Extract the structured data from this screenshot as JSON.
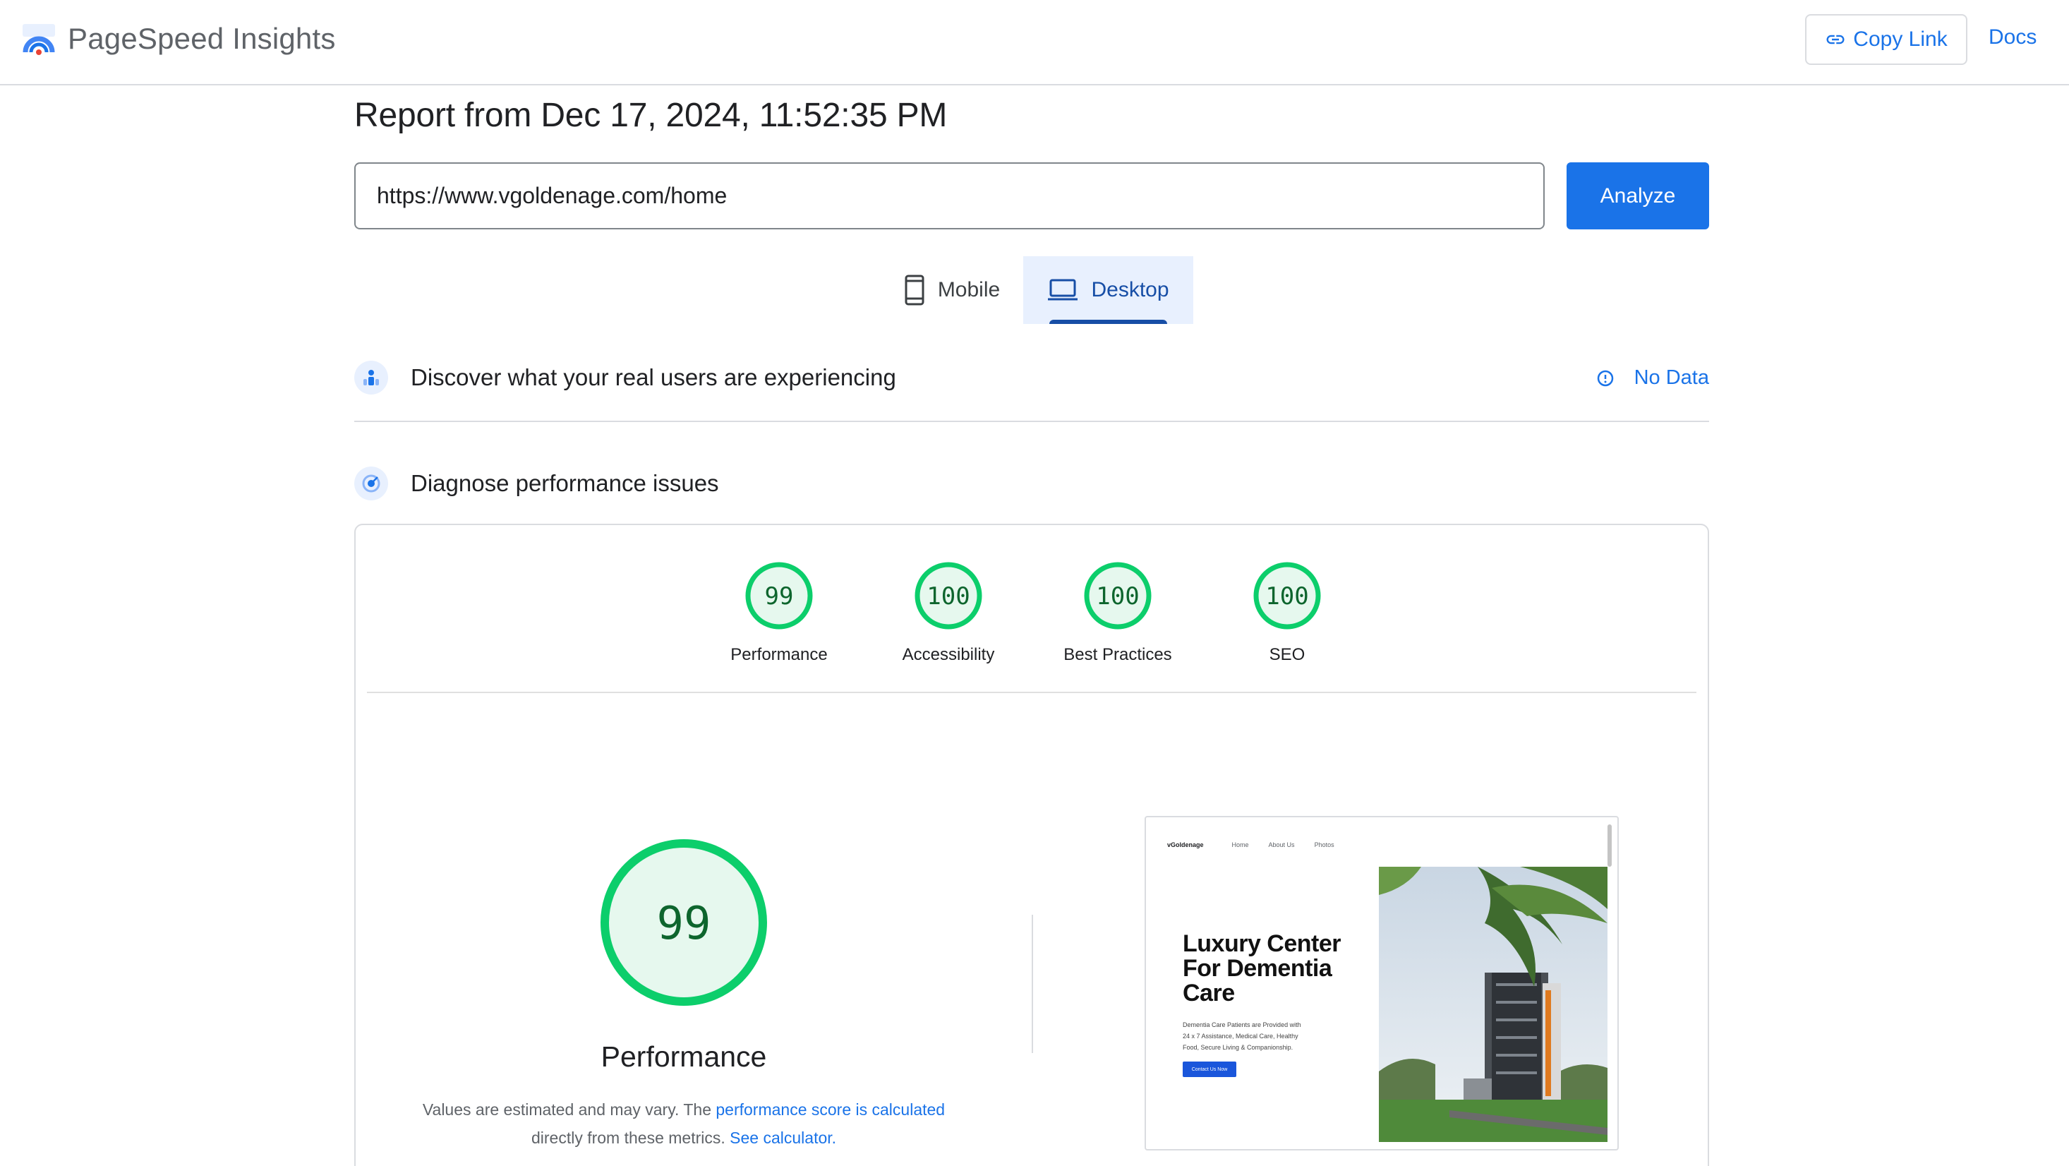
{
  "header": {
    "app_title": "PageSpeed Insights",
    "copy_link_label": "Copy Link",
    "docs_label": "Docs"
  },
  "report": {
    "title": "Report from Dec 17, 2024, 11:52:35 PM",
    "url_value": "https://www.vgoldenage.com/home",
    "analyze_label": "Analyze"
  },
  "tabs": [
    {
      "label": "Mobile",
      "selected": false
    },
    {
      "label": "Desktop",
      "selected": true
    }
  ],
  "field_data": {
    "title": "Discover what your real users are experiencing",
    "status": "No Data"
  },
  "diagnose": {
    "title": "Diagnose performance issues",
    "scores": [
      {
        "label": "Performance",
        "score": "99"
      },
      {
        "label": "Accessibility",
        "score": "100"
      },
      {
        "label": "Best Practices",
        "score": "100"
      },
      {
        "label": "SEO",
        "score": "100"
      }
    ],
    "main_score": "99",
    "main_label": "Performance",
    "explain_prefix": "Values are estimated and may vary. The",
    "explain_link": "performance score is calculated",
    "explain_mid": "directly from these metrics.",
    "explain_link2": "See calculator.",
    "score_color": "#0cce6b"
  },
  "screenshot": {
    "site_logo": "vGoldenage",
    "nav_items": [
      "Home",
      "About Us",
      "Photos"
    ],
    "hero_title": "Luxury Center For Dementia Care",
    "hero_sub": "Dementia Care Patients are Provided with 24 x 7 Assistance, Medical Care, Healthy Food, Secure Living & Companionship.",
    "cta_label": "Contact Us Now"
  }
}
